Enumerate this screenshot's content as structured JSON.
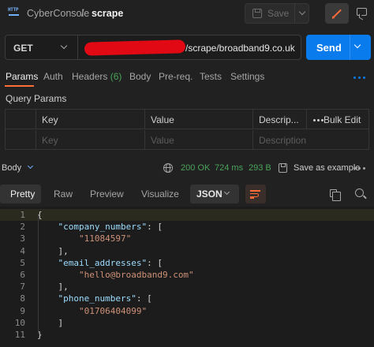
{
  "header": {
    "workspace": "CyberConsole",
    "separator": "/",
    "request_name": "scrape",
    "save_label": "Save"
  },
  "request": {
    "method": "GET",
    "url_visible": "/scrape/broadband9.co.uk",
    "send_label": "Send"
  },
  "request_tabs": [
    {
      "label": "Params",
      "active": true
    },
    {
      "label": "Auth"
    },
    {
      "label": "Headers",
      "count": "(6)"
    },
    {
      "label": "Body"
    },
    {
      "label": "Pre-req."
    },
    {
      "label": "Tests"
    },
    {
      "label": "Settings"
    }
  ],
  "query_params": {
    "title": "Query Params",
    "columns": [
      "Key",
      "Value",
      "Descrip..."
    ],
    "bulk_edit": "Bulk Edit",
    "placeholders": {
      "key": "Key",
      "value": "Value",
      "description": "Description"
    }
  },
  "response": {
    "body_label": "Body",
    "status": "200 OK",
    "time": "724 ms",
    "size": "293 B",
    "save_example": "Save as example",
    "view_tabs": [
      "Pretty",
      "Raw",
      "Preview",
      "Visualize"
    ],
    "format": "JSON",
    "lines": [
      {
        "n": "1",
        "text": "{"
      },
      {
        "n": "2",
        "text": "    \"company_numbers\": ["
      },
      {
        "n": "3",
        "text": "        \"11084597\""
      },
      {
        "n": "4",
        "text": "    ],"
      },
      {
        "n": "5",
        "text": "    \"email_addresses\": ["
      },
      {
        "n": "6",
        "text": "        \"hello@broadband9.com\""
      },
      {
        "n": "7",
        "text": "    ],"
      },
      {
        "n": "8",
        "text": "    \"phone_numbers\": ["
      },
      {
        "n": "9",
        "text": "        \"01706404099\""
      },
      {
        "n": "10",
        "text": "    ]"
      },
      {
        "n": "11",
        "text": "}"
      }
    ]
  },
  "colors": {
    "accent": "#ff6c37",
    "send": "#097bed",
    "status_ok": "#4aa35b",
    "redaction": "#e10a14"
  },
  "icons": [
    "http-icon",
    "floppy-disk-icon",
    "chevron-down-icon",
    "pencil-icon",
    "comment-icon",
    "more-horizontal-icon",
    "globe-icon",
    "copy-icon",
    "search-icon",
    "wrap-lines-icon"
  ]
}
